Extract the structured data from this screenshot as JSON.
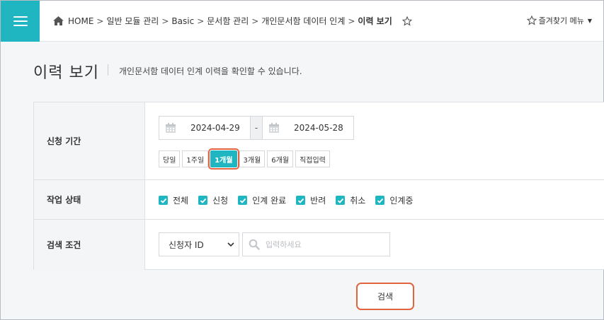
{
  "header": {
    "breadcrumb": {
      "items": [
        "HOME",
        "일반 모듈 관리",
        "Basic",
        "문서함 관리",
        "개인문서함 데이터 인계"
      ],
      "separator": ">",
      "current": "이력 보기"
    },
    "favorites_menu_label": "즐겨찾기 메뉴"
  },
  "page": {
    "title": "이력 보기",
    "description": "개인문서함 데이터 인계 이력을 확인할 수 있습니다."
  },
  "form": {
    "period": {
      "label": "신청 기간",
      "start_date": "2024-04-29",
      "end_date": "2024-05-28",
      "range_sep": "-",
      "buttons": [
        "당일",
        "1주일",
        "1개월",
        "3개월",
        "6개월",
        "직접입력"
      ],
      "active": "1개월"
    },
    "status": {
      "label": "작업 상태",
      "options": [
        {
          "label": "전체",
          "checked": true
        },
        {
          "label": "신청",
          "checked": true
        },
        {
          "label": "인계 완료",
          "checked": true
        },
        {
          "label": "반려",
          "checked": true
        },
        {
          "label": "취소",
          "checked": true
        },
        {
          "label": "인계중",
          "checked": true
        }
      ]
    },
    "condition": {
      "label": "검색 조건",
      "select_value": "신청자 ID",
      "search_placeholder": "입력하세요"
    }
  },
  "actions": {
    "search_label": "검색"
  },
  "colors": {
    "accent": "#1fb6c1",
    "highlight": "#e2643f"
  }
}
